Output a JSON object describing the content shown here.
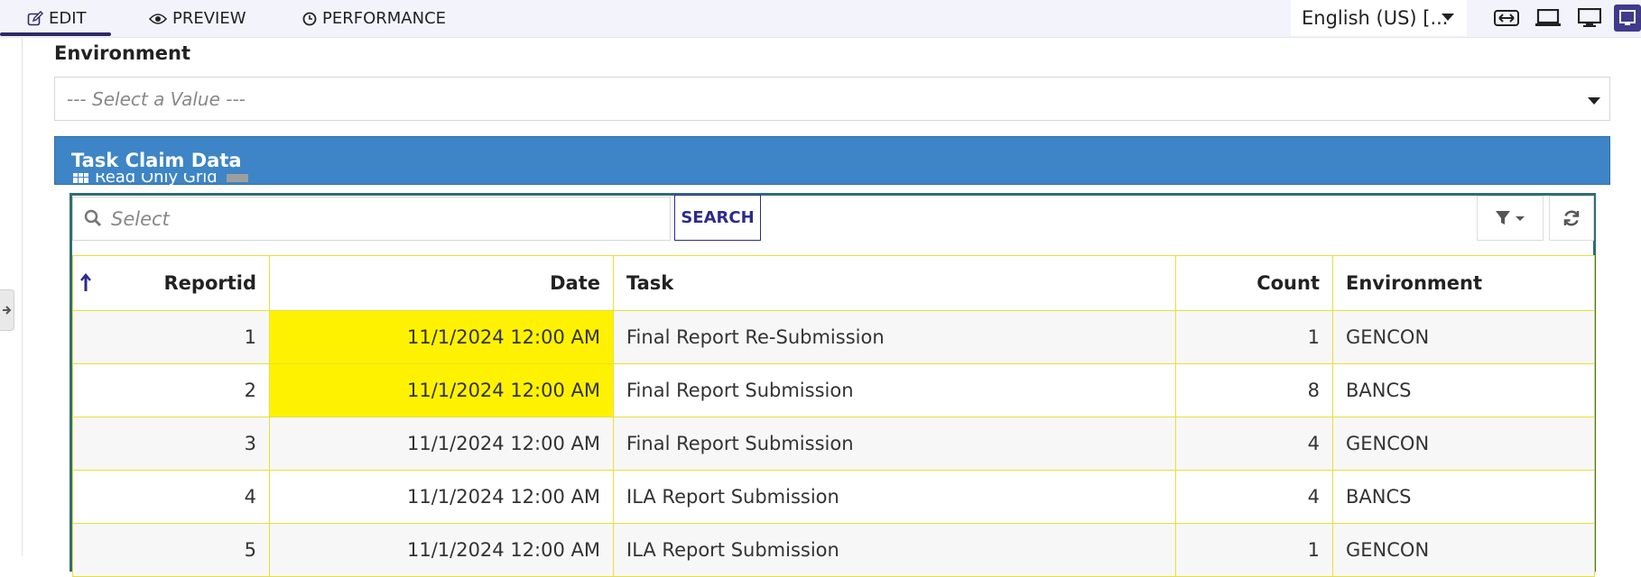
{
  "tabs": {
    "edit": "EDIT",
    "preview": "PREVIEW",
    "performance": "PERFORMANCE"
  },
  "language": "English (US) [...",
  "environment": {
    "label": "Environment",
    "placeholder": "--- Select a Value ---"
  },
  "panel": {
    "title": "Task Claim Data",
    "grid_tag": "Read Only Grid"
  },
  "search": {
    "placeholder": "Select",
    "button": "SEARCH"
  },
  "icons": {
    "edit": "pencil-square-icon",
    "preview": "eye-icon",
    "performance": "clock-icon",
    "search": "magnifier-icon",
    "filter": "funnel-icon",
    "refresh": "refresh-icon",
    "sort": "sort-up-arrow-icon"
  },
  "colors": {
    "accent": "#2d2a64",
    "header_blue": "#3d85c6",
    "highlight": "#fff200",
    "grid_border": "#e8df3a"
  },
  "columns": [
    "Reportid",
    "Date",
    "Task",
    "Count",
    "Environment"
  ],
  "rows": [
    {
      "reportid": "1",
      "date": "11/1/2024 12:00 AM",
      "task": "Final Report Re-Submission",
      "count": "1",
      "environment": "GENCON"
    },
    {
      "reportid": "2",
      "date": "11/1/2024 12:00 AM",
      "task": "Final Report Submission",
      "count": "8",
      "environment": "BANCS"
    },
    {
      "reportid": "3",
      "date": "11/1/2024 12:00 AM",
      "task": "Final Report Submission",
      "count": "4",
      "environment": "GENCON"
    },
    {
      "reportid": "4",
      "date": "11/1/2024 12:00 AM",
      "task": "ILA Report Submission",
      "count": "4",
      "environment": "BANCS"
    },
    {
      "reportid": "5",
      "date": "11/1/2024 12:00 AM",
      "task": "ILA Report Submission",
      "count": "1",
      "environment": "GENCON"
    }
  ]
}
